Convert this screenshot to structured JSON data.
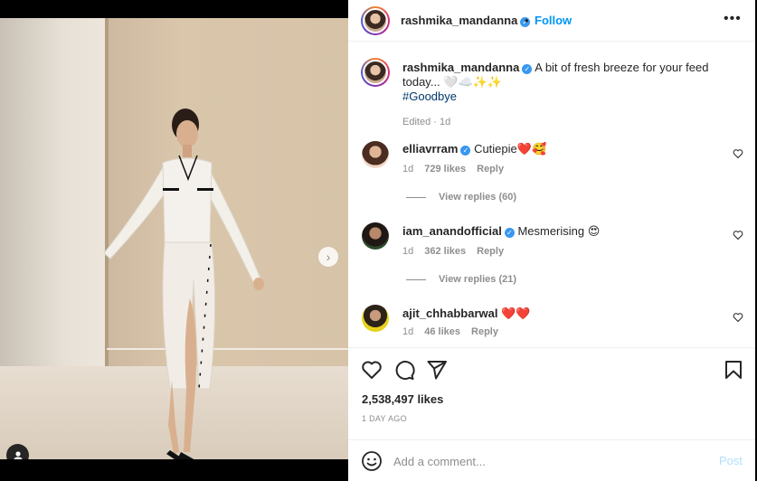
{
  "header": {
    "username": "rashmika_mandanna",
    "separator": "•",
    "follow_label": "Follow",
    "more_label": "•••"
  },
  "caption": {
    "username": "rashmika_mandanna",
    "text": "A bit of fresh breeze for your feed today... 🤍☁️✨✨",
    "hashtag": "#Goodbye",
    "meta": "Edited · 1d"
  },
  "comments": [
    {
      "username": "elliavrram",
      "text": "Cutiepie❤️🥰",
      "age": "1d",
      "likes": "729 likes",
      "reply_label": "Reply",
      "view_replies": "View replies (60)"
    },
    {
      "username": "iam_anandofficial",
      "text": "Mesmerising 😍",
      "age": "1d",
      "likes": "362 likes",
      "reply_label": "Reply",
      "view_replies": "View replies (21)"
    },
    {
      "username": "ajit_chhabbarwal",
      "text": "❤️❤️",
      "age": "1d",
      "likes": "46 likes",
      "reply_label": "Reply"
    }
  ],
  "post": {
    "likes": "2,538,497 likes",
    "time_ago": "1 DAY AGO"
  },
  "add_comment": {
    "placeholder": "Add a comment...",
    "post_label": "Post"
  },
  "carousel": {
    "current": 1,
    "total": 2
  },
  "colors": {
    "accent": "#0095f6",
    "verified": "#3897f0",
    "text": "#262626",
    "muted": "#8e8e8e"
  }
}
